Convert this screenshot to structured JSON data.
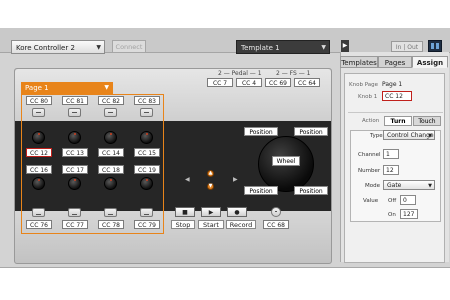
{
  "topbar": {
    "controller_select": "Kore Controller 2",
    "connect_label": "Connect",
    "template_select": "Template 1",
    "inout_label": "In | Out"
  },
  "controller": {
    "page_select": "Page 1",
    "pedal_label": "2 — Pedal — 1",
    "fs_label": "2 — FS — 1",
    "pedal_cc": [
      "CC 7",
      "CC 4",
      "CC 69",
      "CC 64"
    ],
    "top_buttons_cc": [
      "CC 80",
      "CC 81",
      "CC 82",
      "CC 83"
    ],
    "knobs_row1": [
      "CC 12",
      "CC 13",
      "CC 14",
      "CC 15"
    ],
    "knobs_row2": [
      "CC 16",
      "CC 17",
      "CC 18",
      "CC 19"
    ],
    "bottom_buttons_cc": [
      "CC 76",
      "CC 77",
      "CC 78",
      "CC 79"
    ],
    "wheel_label": "Wheel",
    "position_labels": [
      "Position",
      "Position",
      "Position",
      "Position"
    ],
    "transport": {
      "stop": "Stop",
      "start": "Start",
      "record": "Record",
      "extra_cc": "CC 68"
    }
  },
  "panel": {
    "tabs": [
      "Templates",
      "Pages",
      "Assign"
    ],
    "active_tab": "Assign",
    "knob_page_label": "Knob Page",
    "knob_page_value": "Page 1",
    "knob_label": "Knob 1",
    "knob_value": "CC 12",
    "action_label": "Action",
    "subtabs": [
      "Turn",
      "Touch"
    ],
    "type_label": "Type",
    "type_value": "Control Change",
    "channel_label": "Channel",
    "channel_value": "1",
    "number_label": "Number",
    "number_value": "12",
    "mode_label": "Mode",
    "mode_value": "Gate",
    "value_label": "Value",
    "off_label": "Off",
    "off_value": "0",
    "on_label": "On",
    "on_value": "127"
  },
  "colors": {
    "accent": "#e8841a",
    "selected": "#c0201b"
  }
}
